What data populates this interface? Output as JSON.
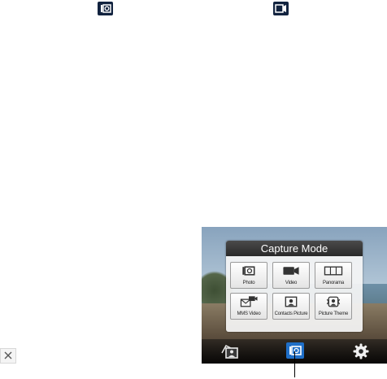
{
  "top_icons": [
    {
      "name": "camera-icon"
    },
    {
      "name": "video-camera-icon"
    }
  ],
  "capture_mode": {
    "title": "Capture Mode",
    "modes": [
      {
        "label": "Photo",
        "icon": "photo-icon"
      },
      {
        "label": "Video",
        "icon": "video-icon"
      },
      {
        "label": "Panorama",
        "icon": "panorama-icon"
      },
      {
        "label": "MMS Video",
        "icon": "mms-video-icon"
      },
      {
        "label": "Contacts Picture",
        "icon": "contacts-picture-icon"
      },
      {
        "label": "Picture Theme",
        "icon": "picture-theme-icon"
      }
    ]
  },
  "bottom_bar": {
    "items": [
      "album-icon",
      "capture-mode-icon",
      "settings-gear-icon"
    ]
  },
  "colors": {
    "accent": "#1f6fc8",
    "icon_dark": "#12233f"
  }
}
